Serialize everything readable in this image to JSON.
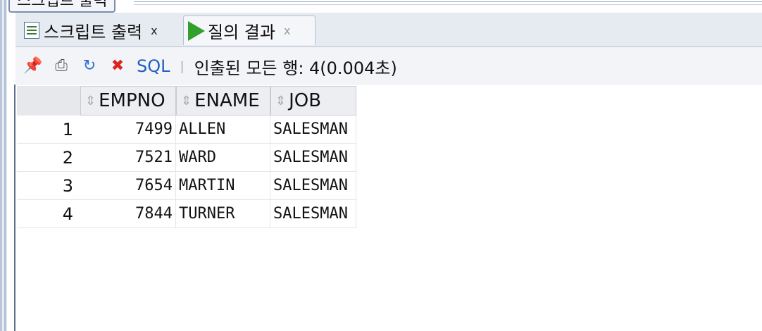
{
  "window": {
    "top_tab_title": "스크립트 출력"
  },
  "tabs": [
    {
      "label": "스크립트 출력",
      "close": "x",
      "icon": "script-doc-icon"
    },
    {
      "label": "질의 결과",
      "close": "x",
      "icon": "run-play-icon"
    }
  ],
  "toolbar": {
    "icons": [
      "pin-icon",
      "print-icon",
      "refresh-icon",
      "delete-icon"
    ],
    "sql_label": "SQL",
    "separator": "|",
    "status": "인출된 모든 행: 4(0.004초)"
  },
  "grid": {
    "columns": [
      "EMPNO",
      "ENAME",
      "JOB"
    ],
    "rows": [
      {
        "n": "1",
        "empno": "7499",
        "ename": "ALLEN",
        "job": "SALESMAN"
      },
      {
        "n": "2",
        "empno": "7521",
        "ename": "WARD",
        "job": "SALESMAN"
      },
      {
        "n": "3",
        "empno": "7654",
        "ename": "MARTIN",
        "job": "SALESMAN"
      },
      {
        "n": "4",
        "empno": "7844",
        "ename": "TURNER",
        "job": "SALESMAN"
      }
    ]
  },
  "colors": {
    "accent_green": "#34a02c",
    "sql_blue": "#1f5fbf",
    "header_bg": "#eceef2"
  }
}
